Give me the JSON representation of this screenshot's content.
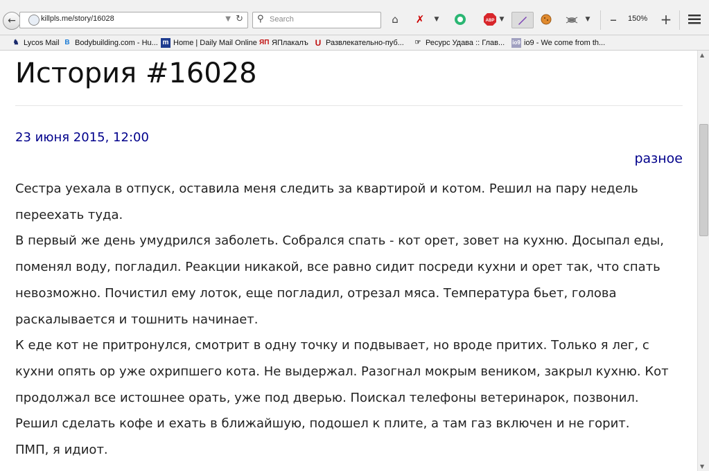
{
  "browser": {
    "url": "killpls.me/story/16028",
    "search_placeholder": "Search",
    "zoom": "150%",
    "icons": [
      "back-icon",
      "home-icon",
      "acrobat-icon",
      "circle-a-icon",
      "adblock-icon",
      "pen-icon",
      "cookie-icon",
      "bug-icon",
      "plus-icon",
      "menu-icon"
    ]
  },
  "bookmarks": [
    {
      "label": "Lycos Mail",
      "icon": "dog-icon"
    },
    {
      "label": "Bodybuilding.com - Hu...",
      "icon": "b-icon"
    },
    {
      "label": "Home | Daily Mail Online",
      "icon": "m-icon"
    },
    {
      "label": "ЯПлакалъ",
      "icon": "yap-icon"
    },
    {
      "label": "Развлекательно-пуб...",
      "icon": "u-icon"
    },
    {
      "label": "Ресурс Удава :: Глав...",
      "icon": "hand-icon"
    },
    {
      "label": "io9 - We come from th...",
      "icon": "io9-icon"
    }
  ],
  "page": {
    "title": "История #16028",
    "date": "23 июня 2015, 12:00",
    "category": "разное",
    "paragraphs": [
      "Сестра уехала в отпуск, оставила меня следить за квартирой и котом. Решил на пару недель переехать туда.",
      "В первый же день умудрился заболеть. Собрался спать - кот орет, зовет на кухню. Досыпал еды, поменял воду, погладил. Реакции никакой, все равно сидит посреди кухни и орет так, что спать невозможно. Почистил ему лоток, еще погладил, отрезал мяса. Температура бьет, голова раскалывается и тошнить начинает.",
      "К еде кот не притронулся, смотрит в одну точку и подвывает, но вроде притих. Только я лег, с кухни опять ор уже охрипшего кота. Не выдержал. Разогнал мокрым веником, закрыл кухню. Кот продолжал все истошнее орать, уже под дверью. Поискал телефоны ветеринарок, позвонил. Решил сделать кофе и ехать в ближайшую, подошел к плите, а там газ включен и не горит.",
      "ПМП, я идиот."
    ]
  },
  "colors": {
    "link": "#00008b",
    "text": "#222222",
    "toolbar": "#f1f1f1"
  }
}
